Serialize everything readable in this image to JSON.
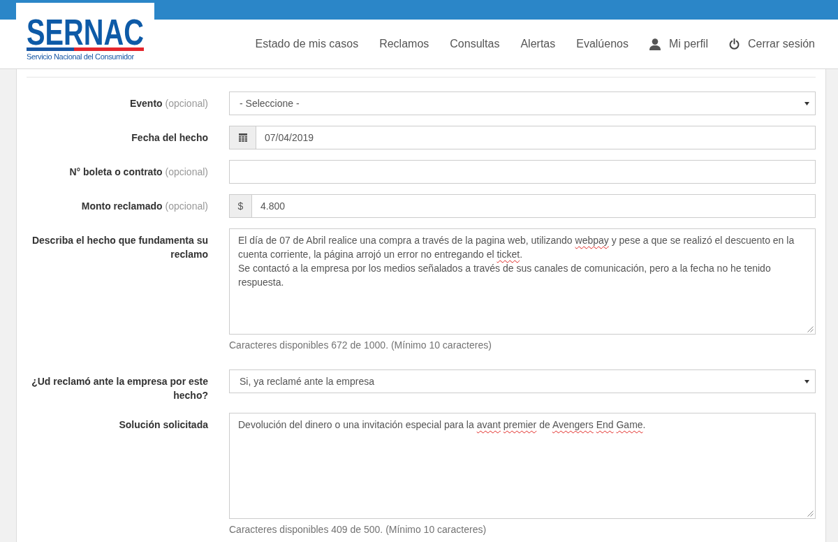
{
  "header": {
    "logo": {
      "title": "SERNAC",
      "subtitle": "Servicio Nacional del Consumidor"
    },
    "nav": [
      {
        "label": "Estado de mis casos",
        "kind": "link"
      },
      {
        "label": "Reclamos",
        "kind": "link"
      },
      {
        "label": "Consultas",
        "kind": "link"
      },
      {
        "label": "Alertas",
        "kind": "link"
      },
      {
        "label": "Evalúenos",
        "kind": "link"
      },
      {
        "label": "Mi perfil",
        "kind": "profile"
      },
      {
        "label": "Cerrar sesión",
        "kind": "logout"
      }
    ]
  },
  "form": {
    "rows": [
      {
        "kind": "select",
        "label": "Evento",
        "hint": "(opcional)",
        "value": "- Seleccione -"
      },
      {
        "kind": "date",
        "label": "Fecha del hecho",
        "value": "07/04/2019"
      },
      {
        "kind": "text",
        "label": "N° boleta o contrato",
        "hint": "(opcional)"
      },
      {
        "kind": "currency",
        "label": "Monto reclamado",
        "hint": "(opcional)",
        "addon": "$",
        "value": "4.800"
      },
      {
        "kind": "textarea",
        "label": "Describa el hecho que fundamenta su reclamo",
        "value": [
          {
            "text": "El día de 07 de Abril realice una compra a través de la pagina web, utilizando ",
            "misspelled": false
          },
          {
            "text": "webpay",
            "misspelled": true
          },
          {
            "text": " y pese a que se realizó el descuento en la cuenta corriente, la página arrojó un error no entregando el ",
            "misspelled": false
          },
          {
            "text": "ticket",
            "misspelled": true
          },
          {
            "text": ".\nSe contactó a la empresa por los medios señalados a través de sus canales de comunicación, pero a la fecha no he tenido respuesta.",
            "misspelled": false
          }
        ],
        "help": "Caracteres disponibles 672 de 1000. (Mínimo 10 caracteres)"
      },
      {
        "kind": "select",
        "label": "¿Ud reclamó ante la empresa por este hecho?",
        "value": "Si, ya reclamé ante la empresa"
      },
      {
        "kind": "textarea",
        "label": "Solución solicitada",
        "value": [
          {
            "text": "Devolución del dinero o una invitación especial para la ",
            "misspelled": false
          },
          {
            "text": "avant premier",
            "misspelled": true
          },
          {
            "text": " de ",
            "misspelled": false
          },
          {
            "text": "Avengers End Game",
            "misspelled": true
          },
          {
            "text": ".",
            "misspelled": false
          }
        ],
        "help": "Caracteres disponibles 409 de 500. (Mínimo 10 caracteres)"
      }
    ]
  }
}
